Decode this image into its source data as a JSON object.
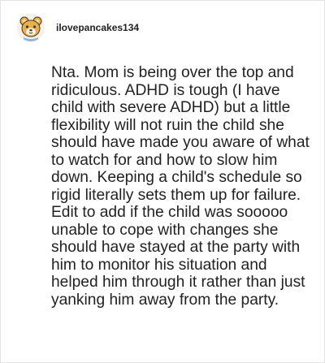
{
  "comment": {
    "author": {
      "username": "ilovepancakes134",
      "avatar_icon": "bear-mascot-icon"
    },
    "text": "Nta. Mom is being over the top and ridiculous. ADHD is tough (I have child with severe ADHD) but a little flexibility will not ruin the child she should have made you aware of what to watch for and how to slow him down. Keeping a child's schedule so rigid literally sets them up for failure. Edit to add if the child was sooooo unable to cope with changes she should have stayed at the party with him to monitor his situation and helped him through it rather than just yanking him away from the party."
  },
  "colors": {
    "text": "#222222",
    "border": "#e4e4e4",
    "avatar_tan": "#e7b24a",
    "avatar_dark": "#4a3a2a"
  }
}
